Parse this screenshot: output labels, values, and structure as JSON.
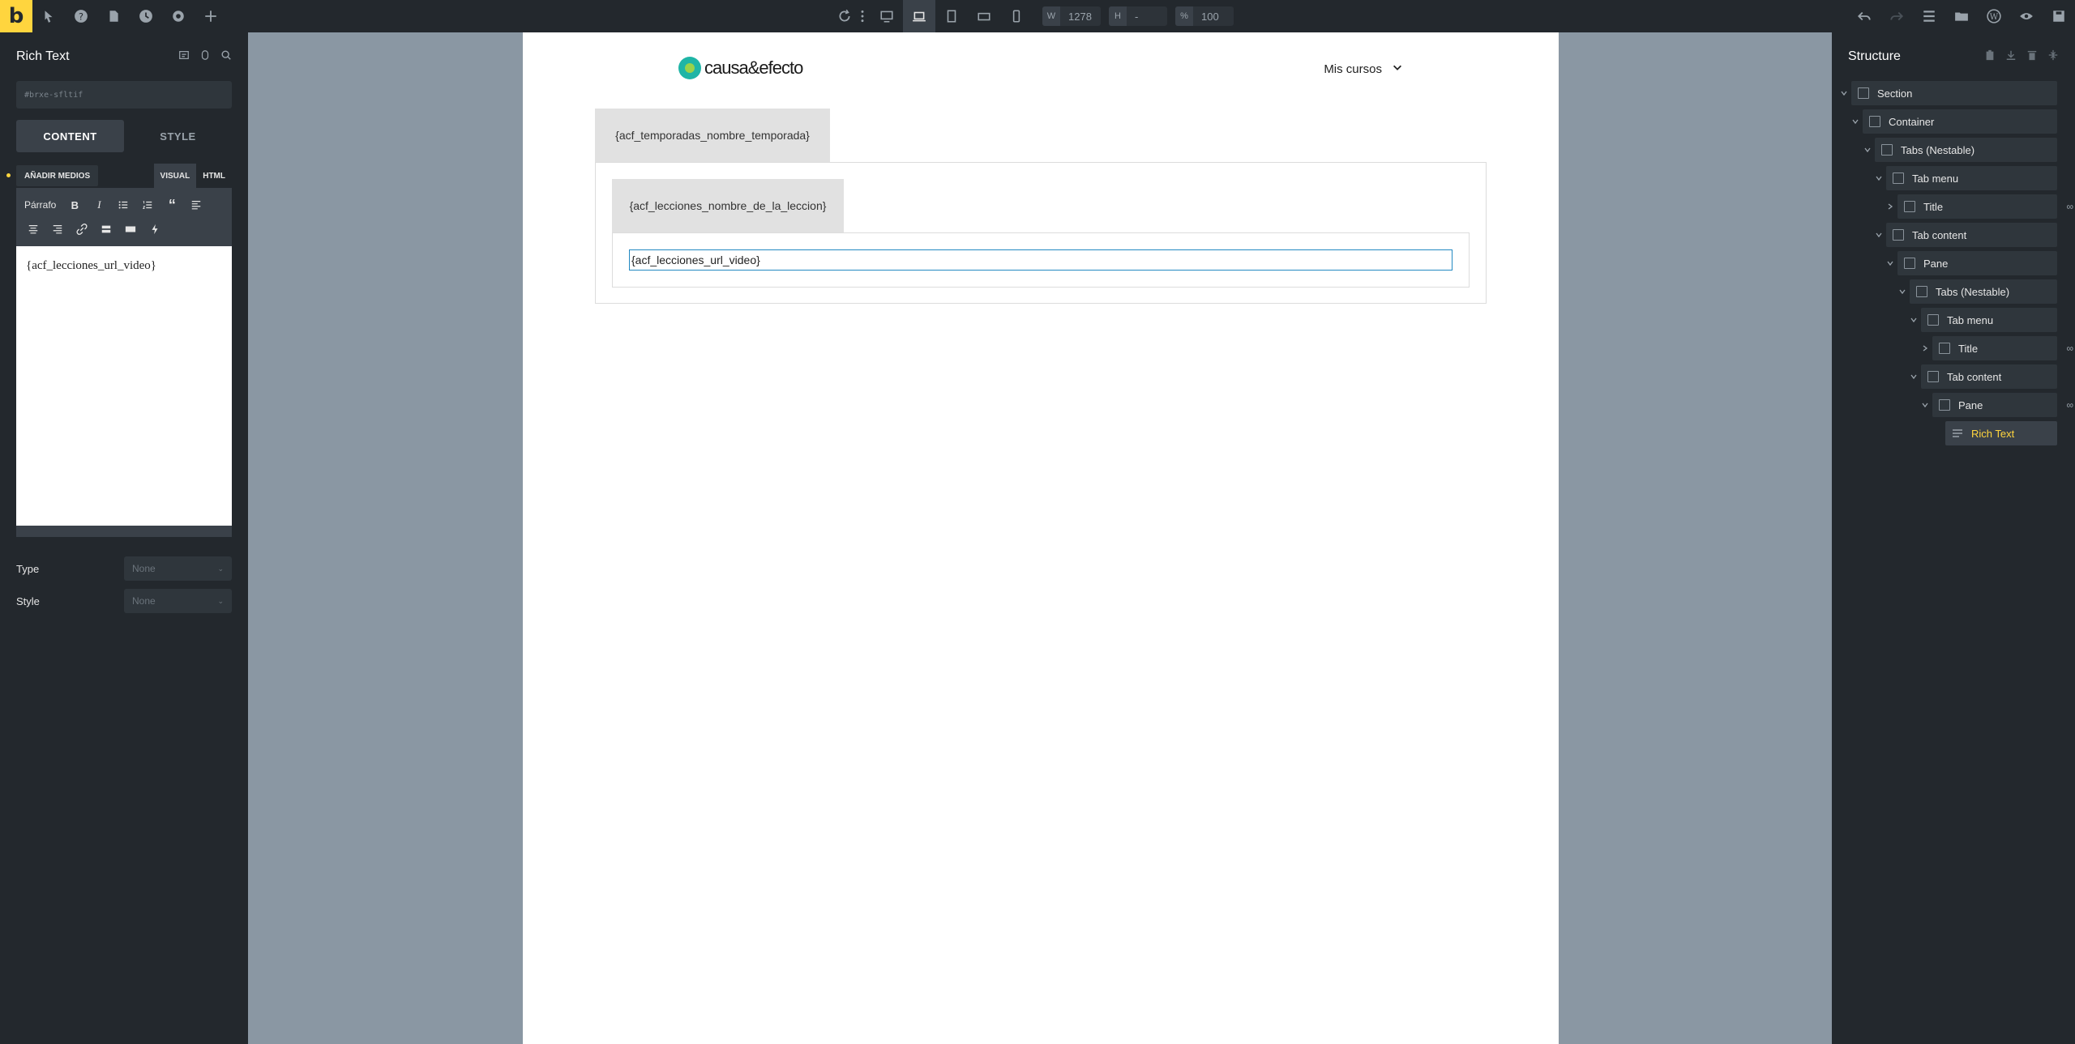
{
  "topbar": {
    "logo": "b",
    "width_label": "W",
    "width_value": "1278",
    "height_label": "H",
    "height_value": "-",
    "zoom_label": "%",
    "zoom_value": "100"
  },
  "left_panel": {
    "title": "Rich Text",
    "css_id": "#brxe-sfltif",
    "tabs": [
      "CONTENT",
      "STYLE"
    ],
    "add_media": "AÑADIR MEDIOS",
    "mode_tabs": [
      "VISUAL",
      "HTML"
    ],
    "paragraph_label": "Párrafo",
    "editor_text": "{acf_lecciones_url_video}",
    "controls": [
      {
        "label": "Type",
        "value": "None"
      },
      {
        "label": "Style",
        "value": "None"
      }
    ]
  },
  "canvas": {
    "brand": "causa&efecto",
    "menu_label": "Mis cursos",
    "outer_tab": "{acf_temporadas_nombre_temporada}",
    "inner_tab": "{acf_lecciones_nombre_de_la_leccion}",
    "rich_text": "{acf_lecciones_url_video}"
  },
  "structure": {
    "title": "Structure",
    "nodes": [
      "Section",
      "Container",
      "Tabs (Nestable)",
      "Tab menu",
      "Title",
      "Tab content",
      "Pane",
      "Tabs (Nestable)",
      "Tab menu",
      "Title",
      "Tab content",
      "Pane",
      "Rich Text"
    ]
  },
  "colors": {
    "accent": "#ffd53e",
    "panel_bg": "#23282d",
    "canvas_bg": "#8a97a3",
    "selection_border": "#2389c2"
  }
}
